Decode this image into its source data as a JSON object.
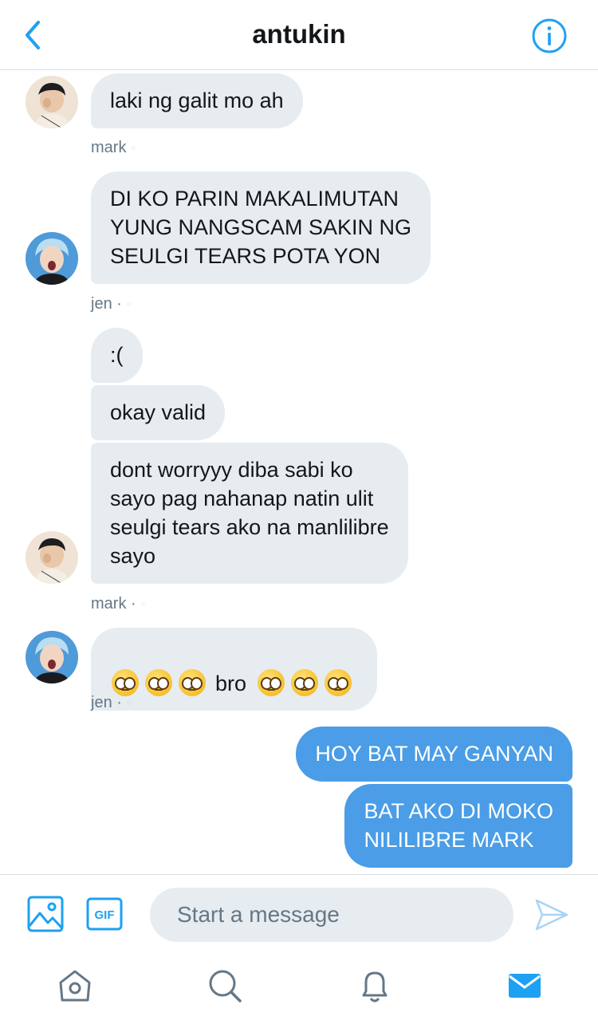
{
  "header": {
    "title": "antukin"
  },
  "messages": {
    "m1": "laki ng galit mo ah",
    "m1_meta": "mark",
    "m2": "DI KO PARIN MAKALIMUTAN\nYUNG NANGSCAM SAKIN NG\nSEULGI TEARS POTA YON",
    "m2_meta": "jen · ",
    "m3": ":(",
    "m4": "okay valid",
    "m5": "dont worryyy diba sabi ko\nsayo pag nahanap natin ulit\nseulgi tears ako na manlilibre\nsayo",
    "m5_meta": "mark · ",
    "m6_text": "bro",
    "m6_emoji": "pleading-face",
    "m6_meta": "jen · ",
    "m7": "HOY BAT MAY GANYAN",
    "m8": "BAT AKO DI MOKO\nNILILIBRE MARK"
  },
  "composer": {
    "placeholder": "Start a message",
    "gif_label": "GIF"
  },
  "icons": {
    "back": "chevron-left-icon",
    "info": "info-icon",
    "media": "image-icon",
    "gif": "gif-icon",
    "send": "send-icon",
    "home": "home-icon",
    "search": "search-icon",
    "notifications": "bell-icon",
    "messages": "mail-icon"
  },
  "colors": {
    "accent": "#1da1f2",
    "out_bubble": "#4a9de6",
    "in_bubble": "#e6ecf0",
    "meta": "#657786"
  }
}
